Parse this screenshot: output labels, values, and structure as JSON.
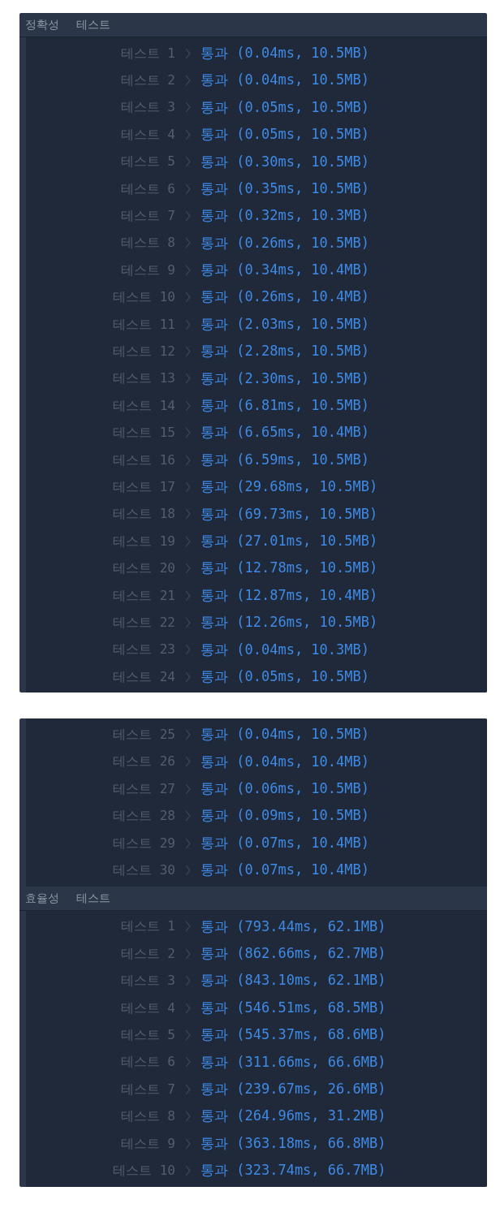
{
  "panels": [
    {
      "groups": [
        {
          "header": {
            "category": "정확성",
            "label": "테스트"
          },
          "tests": [
            {
              "label": "테스트",
              "number": "1",
              "result": "통과 (0.04ms, 10.5MB)"
            },
            {
              "label": "테스트",
              "number": "2",
              "result": "통과 (0.04ms, 10.5MB)"
            },
            {
              "label": "테스트",
              "number": "3",
              "result": "통과 (0.05ms, 10.5MB)"
            },
            {
              "label": "테스트",
              "number": "4",
              "result": "통과 (0.05ms, 10.5MB)"
            },
            {
              "label": "테스트",
              "number": "5",
              "result": "통과 (0.30ms, 10.5MB)"
            },
            {
              "label": "테스트",
              "number": "6",
              "result": "통과 (0.35ms, 10.5MB)"
            },
            {
              "label": "테스트",
              "number": "7",
              "result": "통과 (0.32ms, 10.3MB)"
            },
            {
              "label": "테스트",
              "number": "8",
              "result": "통과 (0.26ms, 10.5MB)"
            },
            {
              "label": "테스트",
              "number": "9",
              "result": "통과 (0.34ms, 10.4MB)"
            },
            {
              "label": "테스트",
              "number": "10",
              "result": "통과 (0.26ms, 10.4MB)"
            },
            {
              "label": "테스트",
              "number": "11",
              "result": "통과 (2.03ms, 10.5MB)"
            },
            {
              "label": "테스트",
              "number": "12",
              "result": "통과 (2.28ms, 10.5MB)"
            },
            {
              "label": "테스트",
              "number": "13",
              "result": "통과 (2.30ms, 10.5MB)"
            },
            {
              "label": "테스트",
              "number": "14",
              "result": "통과 (6.81ms, 10.5MB)"
            },
            {
              "label": "테스트",
              "number": "15",
              "result": "통과 (6.65ms, 10.4MB)"
            },
            {
              "label": "테스트",
              "number": "16",
              "result": "통과 (6.59ms, 10.5MB)"
            },
            {
              "label": "테스트",
              "number": "17",
              "result": "통과 (29.68ms, 10.5MB)"
            },
            {
              "label": "테스트",
              "number": "18",
              "result": "통과 (69.73ms, 10.5MB)"
            },
            {
              "label": "테스트",
              "number": "19",
              "result": "통과 (27.01ms, 10.5MB)"
            },
            {
              "label": "테스트",
              "number": "20",
              "result": "통과 (12.78ms, 10.5MB)"
            },
            {
              "label": "테스트",
              "number": "21",
              "result": "통과 (12.87ms, 10.4MB)"
            },
            {
              "label": "테스트",
              "number": "22",
              "result": "통과 (12.26ms, 10.5MB)"
            },
            {
              "label": "테스트",
              "number": "23",
              "result": "통과 (0.04ms, 10.3MB)"
            },
            {
              "label": "테스트",
              "number": "24",
              "result": "통과 (0.05ms, 10.5MB)"
            }
          ]
        }
      ]
    },
    {
      "groups": [
        {
          "tests": [
            {
              "label": "테스트",
              "number": "25",
              "result": "통과 (0.04ms, 10.5MB)"
            },
            {
              "label": "테스트",
              "number": "26",
              "result": "통과 (0.04ms, 10.4MB)"
            },
            {
              "label": "테스트",
              "number": "27",
              "result": "통과 (0.06ms, 10.5MB)"
            },
            {
              "label": "테스트",
              "number": "28",
              "result": "통과 (0.09ms, 10.5MB)"
            },
            {
              "label": "테스트",
              "number": "29",
              "result": "통과 (0.07ms, 10.4MB)"
            },
            {
              "label": "테스트",
              "number": "30",
              "result": "통과 (0.07ms, 10.4MB)"
            }
          ]
        },
        {
          "header": {
            "category": "효율성",
            "label": "테스트"
          },
          "tests": [
            {
              "label": "테스트",
              "number": "1",
              "result": "통과 (793.44ms, 62.1MB)"
            },
            {
              "label": "테스트",
              "number": "2",
              "result": "통과 (862.66ms, 62.7MB)"
            },
            {
              "label": "테스트",
              "number": "3",
              "result": "통과 (843.10ms, 62.1MB)"
            },
            {
              "label": "테스트",
              "number": "4",
              "result": "통과 (546.51ms, 68.5MB)"
            },
            {
              "label": "테스트",
              "number": "5",
              "result": "통과 (545.37ms, 68.6MB)"
            },
            {
              "label": "테스트",
              "number": "6",
              "result": "통과 (311.66ms, 66.6MB)"
            },
            {
              "label": "테스트",
              "number": "7",
              "result": "통과 (239.67ms, 26.6MB)"
            },
            {
              "label": "테스트",
              "number": "8",
              "result": "통과 (264.96ms, 31.2MB)"
            },
            {
              "label": "테스트",
              "number": "9",
              "result": "통과 (363.18ms, 66.8MB)"
            },
            {
              "label": "테스트",
              "number": "10",
              "result": "통과 (323.74ms, 66.7MB)"
            }
          ]
        }
      ]
    }
  ]
}
